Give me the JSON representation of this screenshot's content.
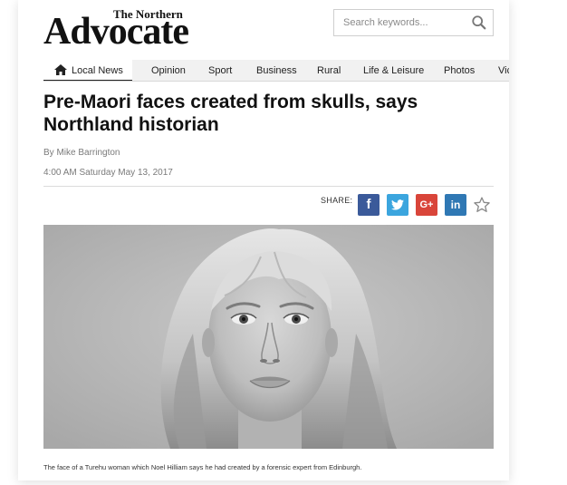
{
  "masthead": {
    "small": "The Northern",
    "big": "Advocate"
  },
  "search": {
    "placeholder": "Search keywords...",
    "icon": "search-icon"
  },
  "nav": {
    "items": [
      {
        "label": "Local News",
        "active": true,
        "icon": "home-icon"
      },
      {
        "label": "Opinion"
      },
      {
        "label": "Sport"
      },
      {
        "label": "Business"
      },
      {
        "label": "Rural"
      },
      {
        "label": "Life & Leisure"
      },
      {
        "label": "Photos"
      },
      {
        "label": "Vic"
      }
    ]
  },
  "article": {
    "headline": "Pre-Maori faces created from skulls, says Northland historian",
    "byline": "By Mike Barrington",
    "dateline": "4:00 AM Saturday May 13, 2017",
    "caption": "The face of a Turehu woman which Noel Hilliam says he had created by a forensic expert from Edinburgh."
  },
  "share": {
    "label": "SHARE:",
    "buttons": [
      {
        "glyph": "f",
        "color": "#3b5a9a",
        "icon": "facebook-icon"
      },
      {
        "glyph": "t",
        "color": "#3ba5de",
        "icon": "twitter-icon"
      },
      {
        "glyph": "G+",
        "color": "#d9453a",
        "icon": "google-plus-icon"
      },
      {
        "glyph": "in",
        "color": "#2f78b4",
        "icon": "linkedin-icon"
      }
    ],
    "bookmark_icon": "star-icon"
  },
  "colors": {
    "facebook": "#3b5a9a",
    "twitter": "#3ba5de",
    "google_plus": "#d9453a",
    "linkedin": "#2f78b4"
  }
}
